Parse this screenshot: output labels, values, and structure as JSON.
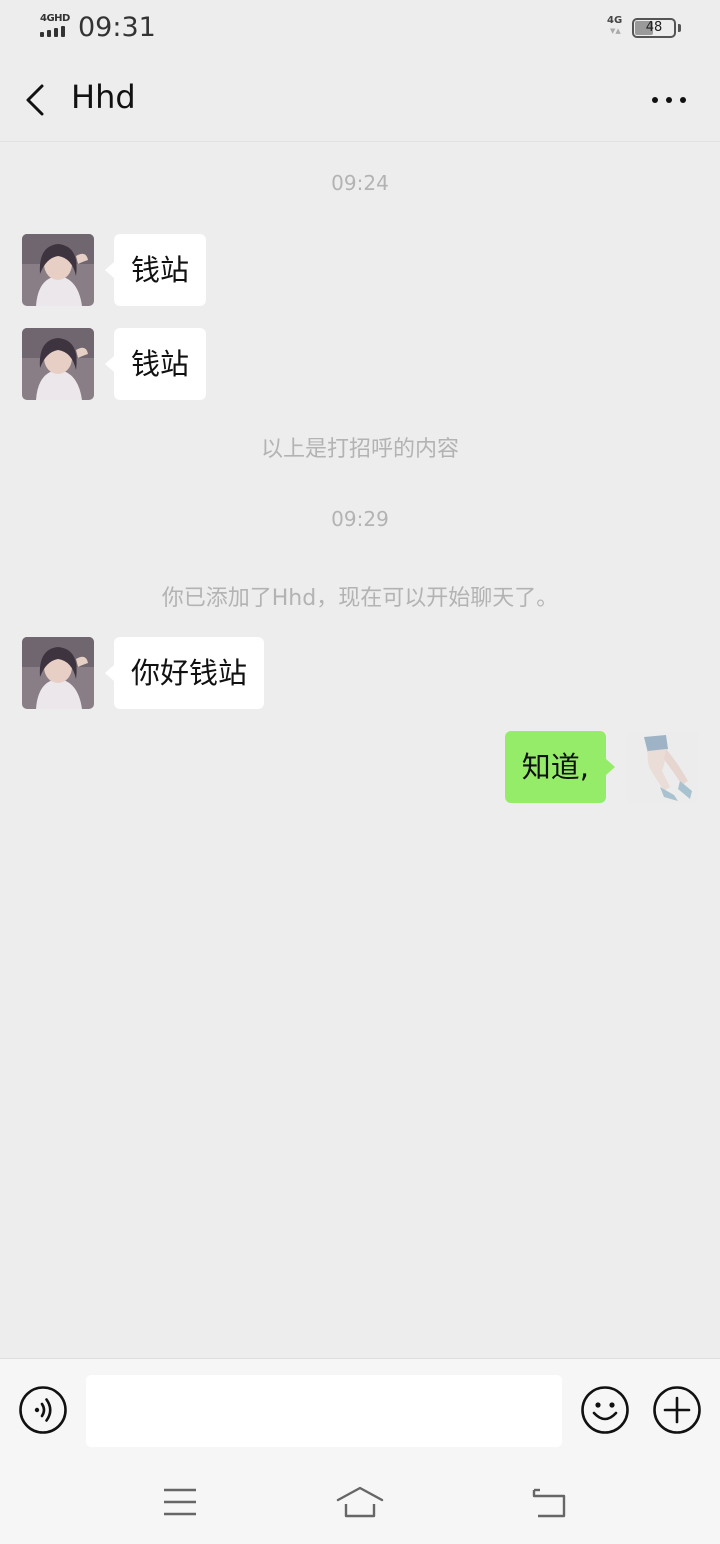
{
  "status_bar": {
    "network_left": "4GHD",
    "time": "09:31",
    "network_right": "4G",
    "battery": "48",
    "battery_level": 0.48
  },
  "header": {
    "title": "Hhd",
    "back_icon": "chevron-left-icon",
    "more_icon": "more-dots-icon"
  },
  "messages": {
    "time_1": "09:24",
    "greeting_1": "钱站",
    "greeting_2": "钱站",
    "greeting_note": "以上是打招呼的内容",
    "time_2": "09:29",
    "added_note": "你已添加了Hhd，现在可以开始聊天了。",
    "incoming_1": "你好钱站",
    "outgoing_1": "知道,"
  },
  "input_bar": {
    "text_value": "",
    "voice_icon": "voice-icon",
    "emoji_icon": "emoji-icon",
    "plus_icon": "plus-icon"
  },
  "system_nav": {
    "menu_icon": "menu-icon",
    "home_icon": "home-icon",
    "back_icon": "return-icon"
  },
  "colors": {
    "background": "#ededed",
    "incoming_bubble": "#ffffff",
    "outgoing_bubble": "#95ec69",
    "meta_text": "#b3b3b3"
  }
}
